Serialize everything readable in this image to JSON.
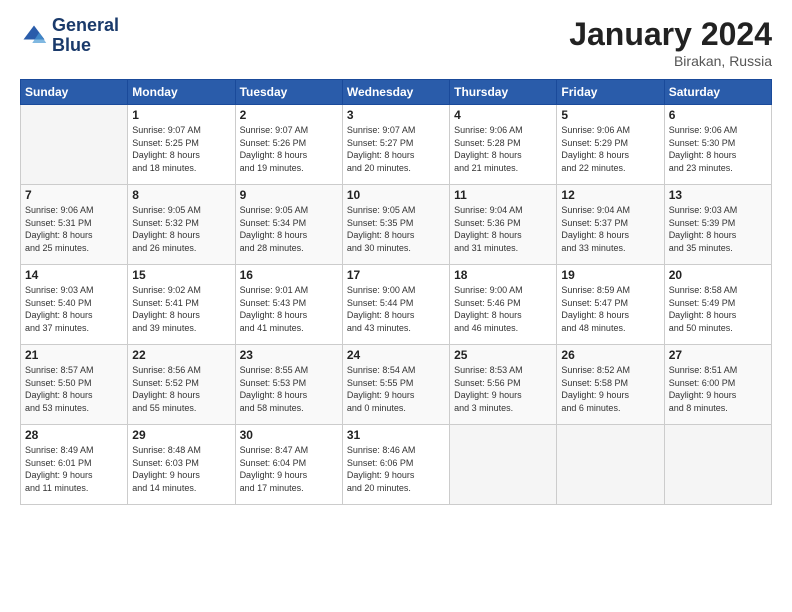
{
  "logo": {
    "line1": "General",
    "line2": "Blue"
  },
  "title": "January 2024",
  "location": "Birakan, Russia",
  "days_header": [
    "Sunday",
    "Monday",
    "Tuesday",
    "Wednesday",
    "Thursday",
    "Friday",
    "Saturday"
  ],
  "weeks": [
    [
      {
        "num": "",
        "info": ""
      },
      {
        "num": "1",
        "info": "Sunrise: 9:07 AM\nSunset: 5:25 PM\nDaylight: 8 hours\nand 18 minutes."
      },
      {
        "num": "2",
        "info": "Sunrise: 9:07 AM\nSunset: 5:26 PM\nDaylight: 8 hours\nand 19 minutes."
      },
      {
        "num": "3",
        "info": "Sunrise: 9:07 AM\nSunset: 5:27 PM\nDaylight: 8 hours\nand 20 minutes."
      },
      {
        "num": "4",
        "info": "Sunrise: 9:06 AM\nSunset: 5:28 PM\nDaylight: 8 hours\nand 21 minutes."
      },
      {
        "num": "5",
        "info": "Sunrise: 9:06 AM\nSunset: 5:29 PM\nDaylight: 8 hours\nand 22 minutes."
      },
      {
        "num": "6",
        "info": "Sunrise: 9:06 AM\nSunset: 5:30 PM\nDaylight: 8 hours\nand 23 minutes."
      }
    ],
    [
      {
        "num": "7",
        "info": "Sunrise: 9:06 AM\nSunset: 5:31 PM\nDaylight: 8 hours\nand 25 minutes."
      },
      {
        "num": "8",
        "info": "Sunrise: 9:05 AM\nSunset: 5:32 PM\nDaylight: 8 hours\nand 26 minutes."
      },
      {
        "num": "9",
        "info": "Sunrise: 9:05 AM\nSunset: 5:34 PM\nDaylight: 8 hours\nand 28 minutes."
      },
      {
        "num": "10",
        "info": "Sunrise: 9:05 AM\nSunset: 5:35 PM\nDaylight: 8 hours\nand 30 minutes."
      },
      {
        "num": "11",
        "info": "Sunrise: 9:04 AM\nSunset: 5:36 PM\nDaylight: 8 hours\nand 31 minutes."
      },
      {
        "num": "12",
        "info": "Sunrise: 9:04 AM\nSunset: 5:37 PM\nDaylight: 8 hours\nand 33 minutes."
      },
      {
        "num": "13",
        "info": "Sunrise: 9:03 AM\nSunset: 5:39 PM\nDaylight: 8 hours\nand 35 minutes."
      }
    ],
    [
      {
        "num": "14",
        "info": "Sunrise: 9:03 AM\nSunset: 5:40 PM\nDaylight: 8 hours\nand 37 minutes."
      },
      {
        "num": "15",
        "info": "Sunrise: 9:02 AM\nSunset: 5:41 PM\nDaylight: 8 hours\nand 39 minutes."
      },
      {
        "num": "16",
        "info": "Sunrise: 9:01 AM\nSunset: 5:43 PM\nDaylight: 8 hours\nand 41 minutes."
      },
      {
        "num": "17",
        "info": "Sunrise: 9:00 AM\nSunset: 5:44 PM\nDaylight: 8 hours\nand 43 minutes."
      },
      {
        "num": "18",
        "info": "Sunrise: 9:00 AM\nSunset: 5:46 PM\nDaylight: 8 hours\nand 46 minutes."
      },
      {
        "num": "19",
        "info": "Sunrise: 8:59 AM\nSunset: 5:47 PM\nDaylight: 8 hours\nand 48 minutes."
      },
      {
        "num": "20",
        "info": "Sunrise: 8:58 AM\nSunset: 5:49 PM\nDaylight: 8 hours\nand 50 minutes."
      }
    ],
    [
      {
        "num": "21",
        "info": "Sunrise: 8:57 AM\nSunset: 5:50 PM\nDaylight: 8 hours\nand 53 minutes."
      },
      {
        "num": "22",
        "info": "Sunrise: 8:56 AM\nSunset: 5:52 PM\nDaylight: 8 hours\nand 55 minutes."
      },
      {
        "num": "23",
        "info": "Sunrise: 8:55 AM\nSunset: 5:53 PM\nDaylight: 8 hours\nand 58 minutes."
      },
      {
        "num": "24",
        "info": "Sunrise: 8:54 AM\nSunset: 5:55 PM\nDaylight: 9 hours\nand 0 minutes."
      },
      {
        "num": "25",
        "info": "Sunrise: 8:53 AM\nSunset: 5:56 PM\nDaylight: 9 hours\nand 3 minutes."
      },
      {
        "num": "26",
        "info": "Sunrise: 8:52 AM\nSunset: 5:58 PM\nDaylight: 9 hours\nand 6 minutes."
      },
      {
        "num": "27",
        "info": "Sunrise: 8:51 AM\nSunset: 6:00 PM\nDaylight: 9 hours\nand 8 minutes."
      }
    ],
    [
      {
        "num": "28",
        "info": "Sunrise: 8:49 AM\nSunset: 6:01 PM\nDaylight: 9 hours\nand 11 minutes."
      },
      {
        "num": "29",
        "info": "Sunrise: 8:48 AM\nSunset: 6:03 PM\nDaylight: 9 hours\nand 14 minutes."
      },
      {
        "num": "30",
        "info": "Sunrise: 8:47 AM\nSunset: 6:04 PM\nDaylight: 9 hours\nand 17 minutes."
      },
      {
        "num": "31",
        "info": "Sunrise: 8:46 AM\nSunset: 6:06 PM\nDaylight: 9 hours\nand 20 minutes."
      },
      {
        "num": "",
        "info": ""
      },
      {
        "num": "",
        "info": ""
      },
      {
        "num": "",
        "info": ""
      }
    ]
  ]
}
